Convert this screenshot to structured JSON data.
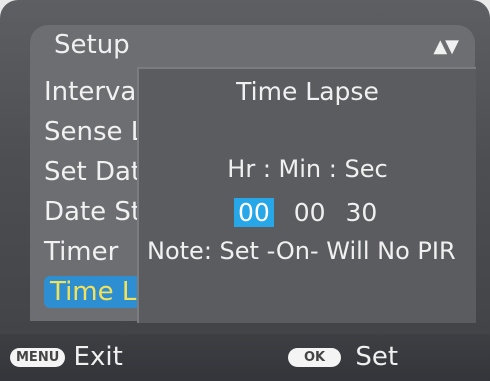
{
  "menu": {
    "title": "Setup",
    "arrows": "▲▼",
    "items": [
      {
        "label": "Interval"
      },
      {
        "label": "Sense L"
      },
      {
        "label": "Set Dat"
      },
      {
        "label": "Date St"
      },
      {
        "label": "Timer"
      },
      {
        "label": "Time La",
        "selected": true
      }
    ]
  },
  "dialog": {
    "title": "Time Lapse",
    "labels": "Hr : Min : Sec",
    "hour": "00",
    "minute": "00",
    "second": "30",
    "note": "Note: Set -On- Will No PIR"
  },
  "bottom_bar": {
    "menu_button_label": "MENU",
    "exit_label": "Exit",
    "ok_button_label": "OK",
    "set_label": "Set"
  },
  "colors": {
    "highlight": "#2d8fd1",
    "selected_text": "#f4e15a",
    "active_field": "#28a7e8"
  }
}
